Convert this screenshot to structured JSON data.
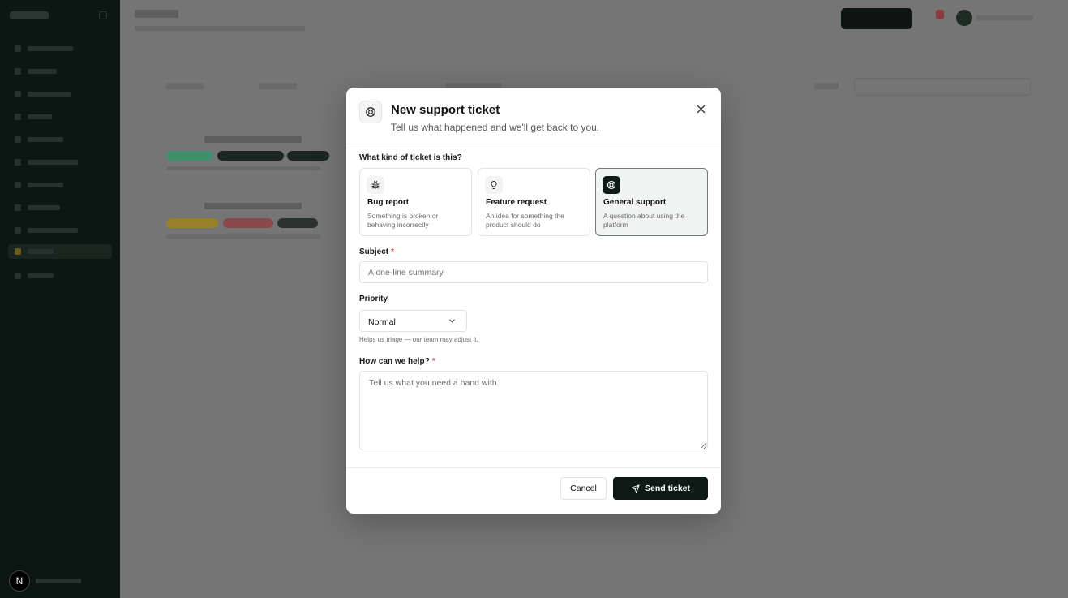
{
  "app": {
    "sidebar_avatar_initial": "N"
  },
  "modal": {
    "title": "New support ticket",
    "subtitle": "Tell us what happened and we'll get back to you.",
    "header_icon": "lifebuoy-icon",
    "close_icon": "close-icon",
    "type_question": "What kind of ticket is this?",
    "ticket_types": [
      {
        "title": "Bug report",
        "description": "Something is broken or behaving incorrectly",
        "icon": "bug-icon",
        "selected": false
      },
      {
        "title": "Feature request",
        "description": "An idea for something the product should do",
        "icon": "lightbulb-icon",
        "selected": false
      },
      {
        "title": "General support",
        "description": "A question about using the platform",
        "icon": "lifebuoy-icon",
        "selected": true
      }
    ],
    "subject": {
      "label": "Subject",
      "required_mark": "*",
      "placeholder": "A one-line summary",
      "value": ""
    },
    "priority": {
      "label": "Priority",
      "value": "Normal",
      "hint": "Helps us triage — our team may adjust it."
    },
    "help": {
      "label": "How can we help?",
      "required_mark": "*",
      "placeholder": "Tell us what you need a hand with.",
      "value": ""
    },
    "footer": {
      "cancel_label": "Cancel",
      "send_label": "Send ticket",
      "send_icon": "send-icon"
    }
  },
  "colors": {
    "primary": "#0e1a16",
    "required": "#d9534f",
    "overlay": "#757575",
    "sidebar": "#0c1713"
  }
}
